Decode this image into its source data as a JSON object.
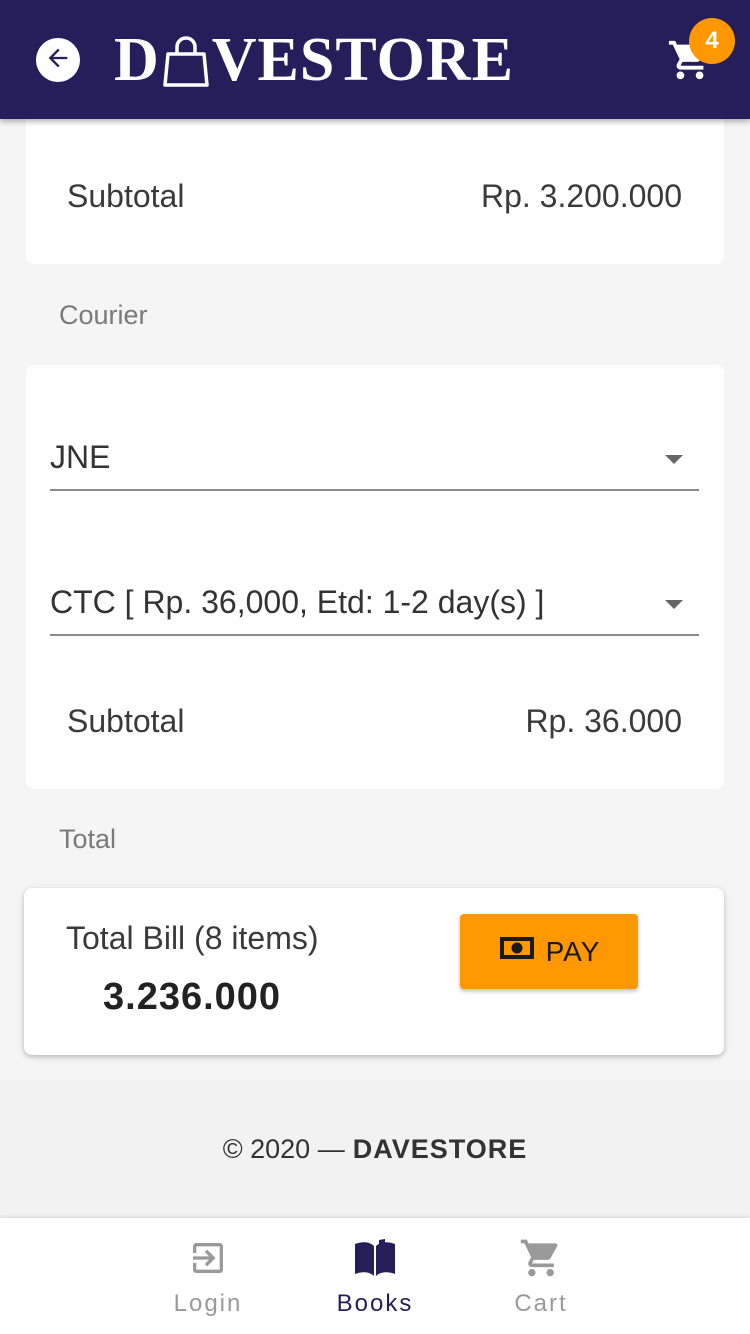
{
  "header": {
    "brand_before": "D",
    "brand_after": "VESTORE",
    "cart_count": "4",
    "icons": {
      "back": "arrow-left-icon",
      "logo_a": "shopping-bag-icon",
      "cart": "cart-icon"
    }
  },
  "products_card": {
    "subtotal_label": "Subtotal",
    "subtotal_value": "Rp. 3.200.000"
  },
  "courier": {
    "section_title": "Courier",
    "courier_select": "JNE",
    "service_select": "CTC [ Rp. 36,000, Etd: 1-2 day(s) ]",
    "subtotal_label": "Subtotal",
    "subtotal_value": "Rp. 36.000"
  },
  "total": {
    "section_title": "Total",
    "bill_label": "Total Bill (8 items)",
    "amount": "3.236.000",
    "pay_label": "PAY",
    "pay_icon": "money-icon"
  },
  "footer": {
    "copyright": "© 2020 —",
    "brand": "DAVESTORE"
  },
  "bottom_nav": {
    "items": [
      {
        "label": "Login",
        "icon": "login-icon",
        "active": false
      },
      {
        "label": "Books",
        "icon": "book-icon",
        "active": true
      },
      {
        "label": "Cart",
        "icon": "cart-icon",
        "active": false
      }
    ]
  },
  "colors": {
    "app_bar": "#261e5b",
    "accent": "#ff9800",
    "background": "#f5f5f5"
  }
}
